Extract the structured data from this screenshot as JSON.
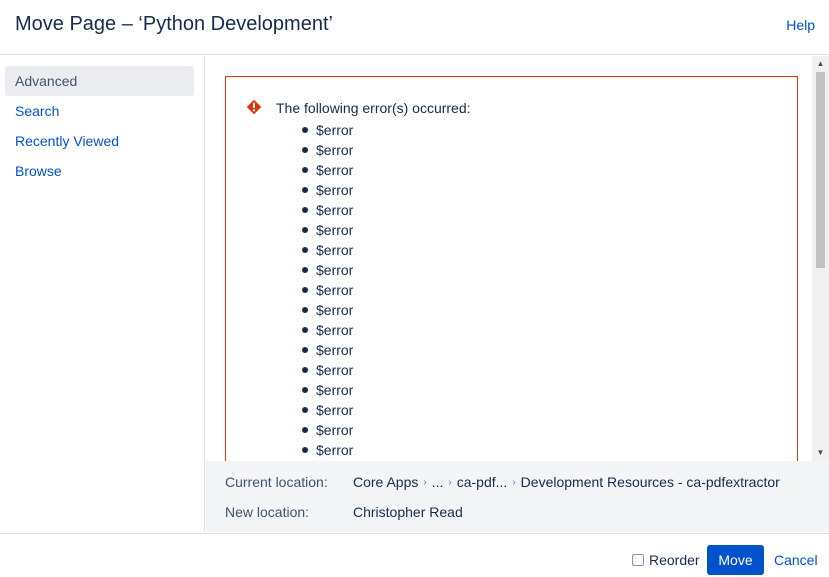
{
  "dialog": {
    "title": "Move Page – ‘Python Development’",
    "help_label": "Help"
  },
  "sidebar": {
    "items": [
      {
        "label": "Advanced",
        "active": true
      },
      {
        "label": "Search",
        "active": false
      },
      {
        "label": "Recently Viewed",
        "active": false
      },
      {
        "label": "Browse",
        "active": false
      }
    ]
  },
  "error": {
    "icon": "error-icon",
    "color": "#de350b",
    "title": "The following error(s) occurred:",
    "items": [
      "$error",
      "$error",
      "$error",
      "$error",
      "$error",
      "$error",
      "$error",
      "$error",
      "$error",
      "$error",
      "$error",
      "$error",
      "$error",
      "$error",
      "$error",
      "$error",
      "$error"
    ]
  },
  "location": {
    "current_label": "Current location:",
    "current_path": [
      "Core Apps",
      "...",
      "ca-pdf...",
      "Development Resources - ca-pdfextractor"
    ],
    "new_label": "New location:",
    "new_value": "Christopher Read"
  },
  "footer": {
    "reorder_label": "Reorder",
    "reorder_checked": false,
    "move_label": "Move",
    "cancel_label": "Cancel"
  },
  "colors": {
    "primary": "#0052cc",
    "error": "#de350b",
    "text": "#172b4d"
  }
}
